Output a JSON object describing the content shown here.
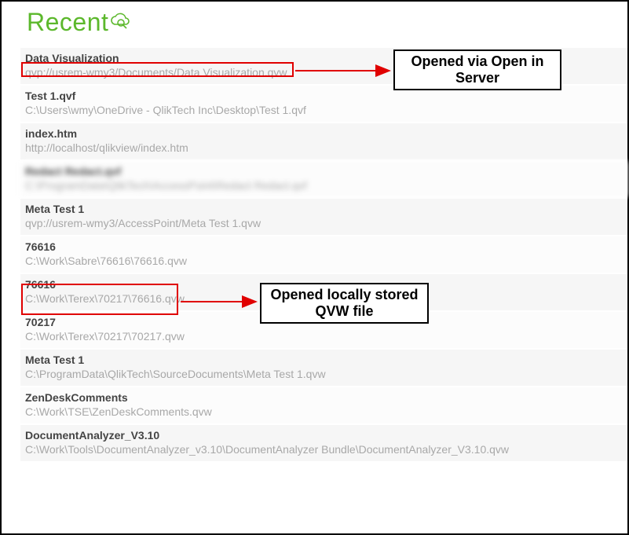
{
  "header": {
    "title": "Recent"
  },
  "items": [
    {
      "title": "Data Visualization",
      "path": "qvp://usrem-wmy3/Documents/Data Visualization.qvw",
      "blurred": false
    },
    {
      "title": "Test 1.qvf",
      "path": "C:\\Users\\wmy\\OneDrive - QlikTech Inc\\Desktop\\Test 1.qvf",
      "blurred": false
    },
    {
      "title": "index.htm",
      "path": "http://localhost/qlikview/index.htm",
      "blurred": false
    },
    {
      "title": "Redact Redact.qvf",
      "path": "C:\\ProgramData\\QlikTech\\AccessPoint\\Redact Redact.qvf",
      "blurred": true
    },
    {
      "title": "Meta Test 1",
      "path": "qvp://usrem-wmy3/AccessPoint/Meta Test 1.qvw",
      "blurred": false
    },
    {
      "title": "76616",
      "path": "C:\\Work\\Sabre\\76616\\76616.qvw",
      "blurred": false
    },
    {
      "title": "76616",
      "path": "C:\\Work\\Terex\\70217\\76616.qvw",
      "blurred": false
    },
    {
      "title": "70217",
      "path": "C:\\Work\\Terex\\70217\\70217.qvw",
      "blurred": false
    },
    {
      "title": "Meta Test 1",
      "path": "C:\\ProgramData\\QlikTech\\SourceDocuments\\Meta Test 1.qvw",
      "blurred": false
    },
    {
      "title": "ZenDeskComments",
      "path": "C:\\Work\\TSE\\ZenDeskComments.qvw",
      "blurred": false
    },
    {
      "title": "DocumentAnalyzer_V3.10",
      "path": "C:\\Work\\Tools\\DocumentAnalyzer_v3.10\\DocumentAnalyzer Bundle\\DocumentAnalyzer_V3.10.qvw",
      "blurred": false
    }
  ],
  "annotations": {
    "callout1": "Opened via Open in Server",
    "callout2": "Opened locally stored QVW file"
  }
}
